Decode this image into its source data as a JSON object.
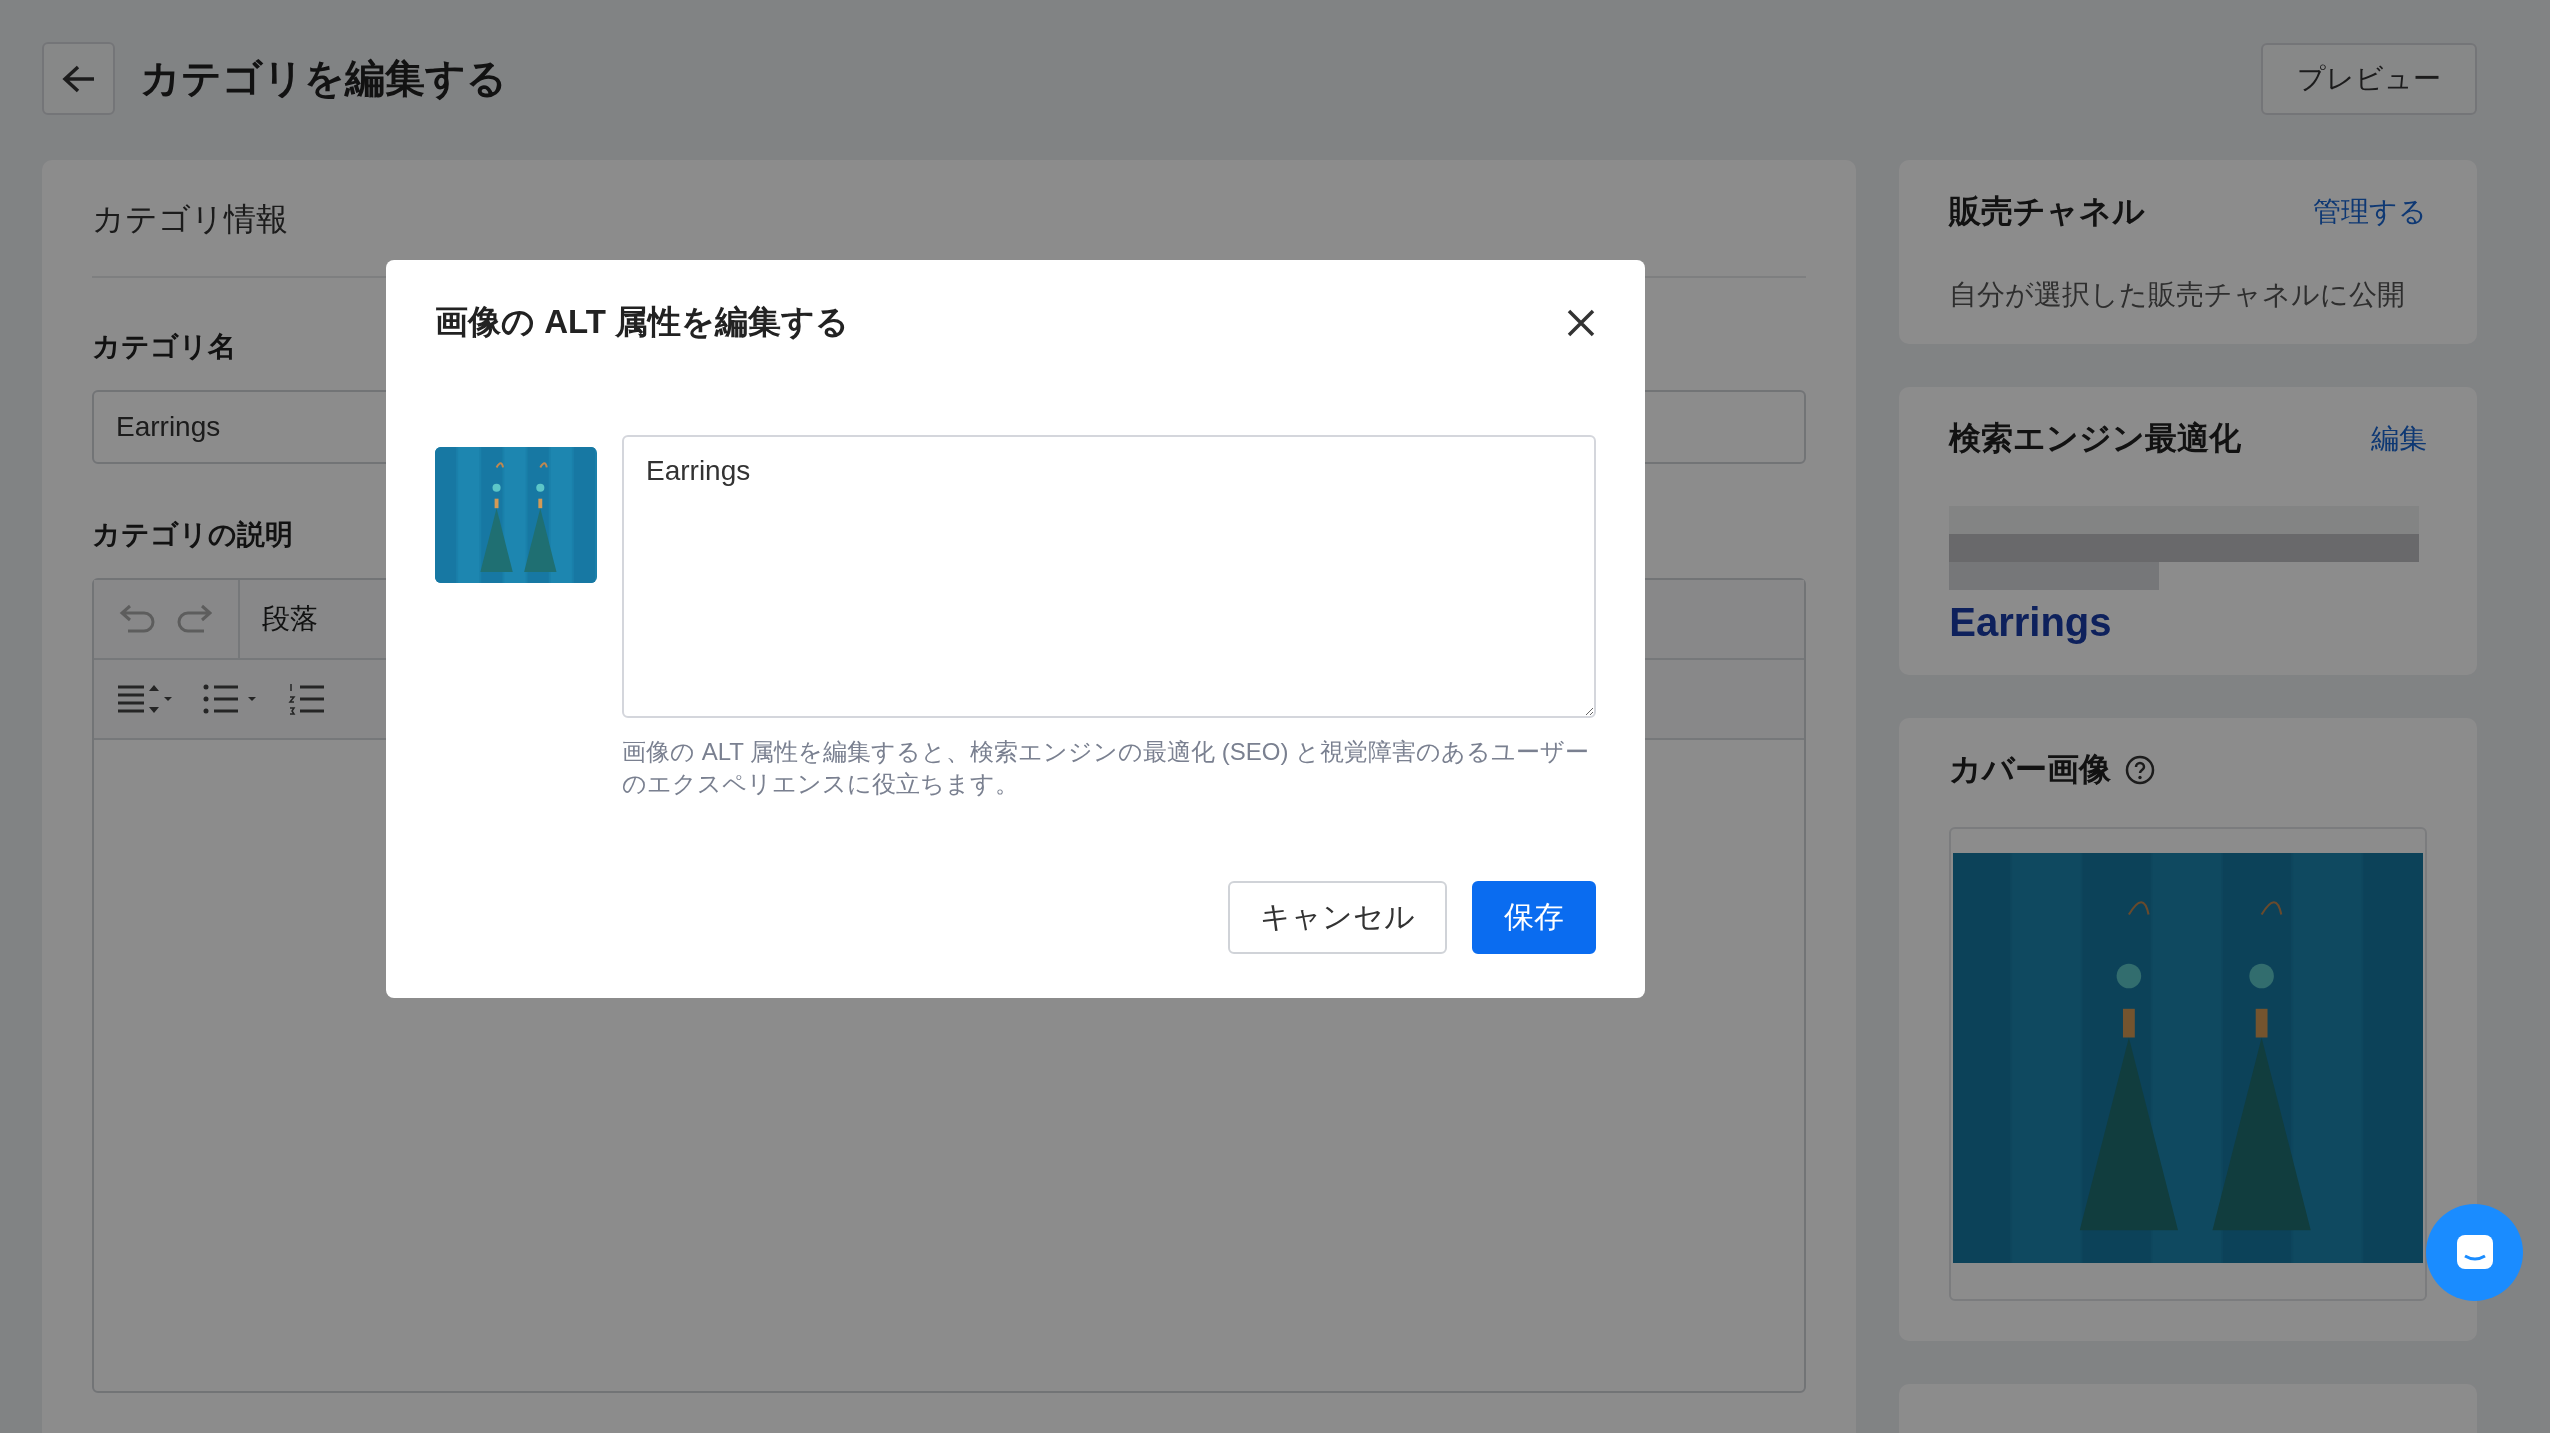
{
  "header": {
    "title": "カテゴリを編集する",
    "preview_button": "プレビュー"
  },
  "category_info": {
    "title": "カテゴリ情報",
    "name_label": "カテゴリ名",
    "name_value": "Earrings",
    "description_label": "カテゴリの説明",
    "paragraph_style": "段落"
  },
  "sales_channel": {
    "title": "販売チャネル",
    "action": "管理する",
    "text": "自分が選択した販売チャネルに公開"
  },
  "seo": {
    "title": "検索エンジン最適化",
    "action": "編集",
    "preview_title": "Earrings"
  },
  "cover_image": {
    "title": "カバー画像"
  },
  "modal": {
    "title": "画像の ALT 属性を編集する",
    "alt_value": "Earrings",
    "hint": "画像の ALT 属性を編集すると、検索エンジンの最適化 (SEO) と視覚障害のあるユーザーのエクスペリエンスに役立ちます。",
    "buttons": [
      {
        "label": "キャンセル",
        "kind": "secondary"
      },
      {
        "label": "保存",
        "kind": "primary"
      }
    ]
  }
}
